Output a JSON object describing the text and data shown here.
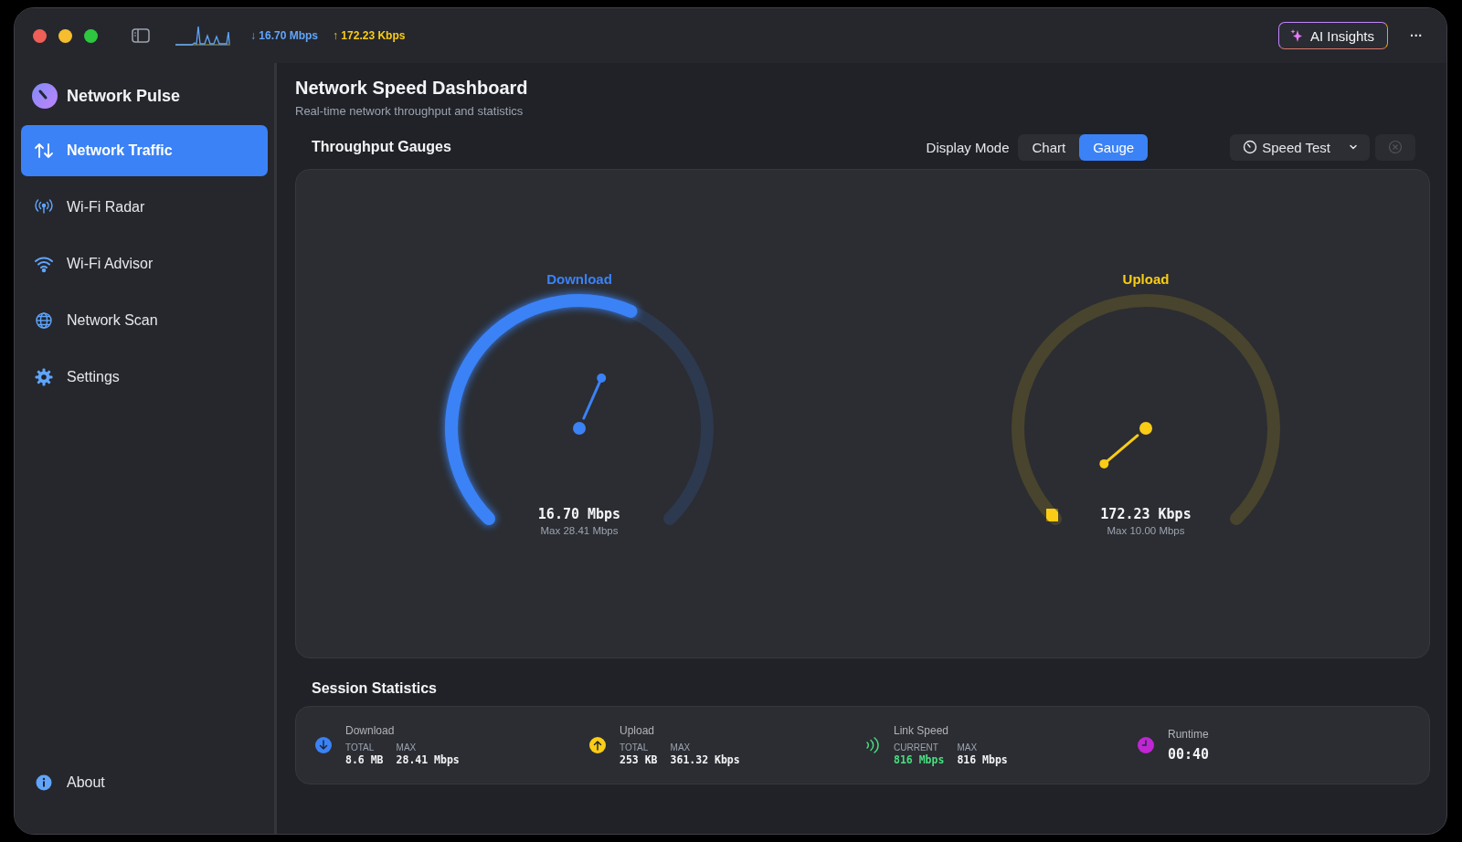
{
  "toolbar": {
    "download_rate": "↓ 16.70 Mbps",
    "upload_rate": "↑ 172.23 Kbps",
    "ai_button": "AI Insights",
    "more": "···"
  },
  "sidebar": {
    "app_name": "Network Pulse",
    "items": [
      {
        "label": "Network Traffic",
        "kind": "traffic",
        "selected": true
      },
      {
        "label": "Wi-Fi Radar",
        "kind": "radar",
        "selected": false
      },
      {
        "label": "Wi-Fi Advisor",
        "kind": "wifi",
        "selected": false
      },
      {
        "label": "Network Scan",
        "kind": "globe",
        "selected": false
      },
      {
        "label": "Settings",
        "kind": "gear",
        "selected": false
      }
    ],
    "footer": {
      "label": "About",
      "kind": "info",
      "selected": false
    }
  },
  "page": {
    "title": "Network Speed Dashboard",
    "subtitle": "Real-time network throughput and statistics"
  },
  "gauges_section": {
    "title": "Throughput Gauges",
    "display_mode_label": "Display Mode",
    "modes": [
      {
        "label": "Chart",
        "selected": false
      },
      {
        "label": "Gauge",
        "selected": true
      }
    ],
    "speed_test": "Speed Test",
    "gauges": [
      {
        "label": "Download",
        "color": "#3b82f6",
        "value": "16.70 Mbps",
        "max": "Max 28.41 Mbps"
      },
      {
        "label": "Upload",
        "color": "#facc15",
        "value": "172.23 Kbps",
        "max": "Max 10.00 Mbps"
      }
    ]
  },
  "session": {
    "title": "Session Statistics",
    "stats": [
      {
        "kind": "download",
        "color": "#3b82f6",
        "label": "Download",
        "values": [
          {
            "label": "TOTAL",
            "value": "8.6 MB",
            "highlight": false
          },
          {
            "label": "MAX",
            "value": "28.41 Mbps",
            "highlight": false
          }
        ]
      },
      {
        "kind": "upload",
        "color": "#facc15",
        "label": "Upload",
        "values": [
          {
            "label": "TOTAL",
            "value": "253 KB",
            "highlight": false
          },
          {
            "label": "MAX",
            "value": "361.32 Kbps",
            "highlight": false
          }
        ]
      },
      {
        "kind": "link",
        "color": "#4ade80",
        "label": "Link Speed",
        "values": [
          {
            "label": "CURRENT",
            "value": "816 Mbps",
            "highlight": true
          },
          {
            "label": "MAX",
            "value": "816 Mbps",
            "highlight": false
          }
        ]
      },
      {
        "kind": "timer",
        "color": "#c026d3",
        "label": "Runtime",
        "value": "00:40"
      }
    ]
  }
}
